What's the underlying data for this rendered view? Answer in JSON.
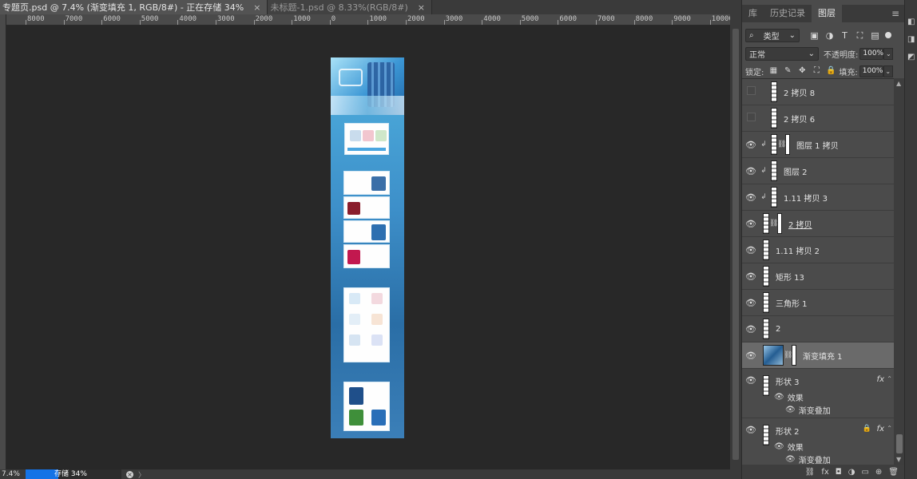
{
  "doc_tabs": [
    {
      "label": "专题页.psd @ 7.4% (渐变填充 1, RGB/8#) - 正在存储 34%",
      "close": "×",
      "active": true
    },
    {
      "label": "未标题-1.psd @ 8.33%(RGB/8#)",
      "close": "×",
      "active": false
    }
  ],
  "ruler_labels": [
    "8000",
    "7000",
    "6000",
    "5000",
    "4000",
    "3000",
    "2000",
    "1000",
    "0",
    "1000",
    "2000",
    "3000",
    "4000",
    "5000",
    "6000",
    "7000",
    "8000",
    "9000",
    "10000"
  ],
  "status": {
    "zoom": "7.4%",
    "progress_text": "存储 34%",
    "progress_fraction": 0.34,
    "cancel_icon": "×",
    "arrow": "〉"
  },
  "panel": {
    "tabs": [
      "库",
      "历史记录",
      "图层"
    ],
    "active_tab": "图层",
    "menu_icon": "≡",
    "filter_label": "类型",
    "blend_mode": "正常",
    "opacity_label": "不透明度:",
    "opacity_value": "100%",
    "lock_label": "锁定:",
    "fill_label": "填充:",
    "fill_value": "100%",
    "icons": {
      "search": "⌕",
      "caret": "⌄",
      "filter_pixel": "▣",
      "filter_adjust": "◑",
      "filter_text": "T",
      "filter_shape": "⛶",
      "filter_smart": "▤",
      "lock_pixels": "▦",
      "lock_brush": "✎",
      "lock_move": "✥",
      "lock_artboard": "⛶",
      "lock_all": "🔒",
      "eye": "👁",
      "chain": "⛓",
      "clip": "↲",
      "lock": "🔒",
      "fx": "fx",
      "expand": "⌃",
      "scroll_up": "▲",
      "scroll_down": "▼"
    },
    "layers": [
      {
        "name": "2 拷贝 8",
        "visible": false
      },
      {
        "name": "2 拷贝 6",
        "visible": false
      },
      {
        "name": "图层 1 拷贝",
        "visible": true,
        "clipped": true,
        "linked": true,
        "mask": true
      },
      {
        "name": "图层 2",
        "visible": true,
        "clipped": true
      },
      {
        "name": "1.11 拷贝 3",
        "visible": true,
        "clipped": true,
        "mask": true
      },
      {
        "name": "2 拷贝",
        "visible": true,
        "linked": true,
        "mask": true,
        "underlined": true
      },
      {
        "name": "1.11 拷贝 2",
        "visible": true
      },
      {
        "name": "矩形 13",
        "visible": true
      },
      {
        "name": "三角形 1",
        "visible": true
      },
      {
        "name": "2",
        "visible": true
      },
      {
        "name": "渐变填充 1",
        "visible": true,
        "selected": true,
        "linked": true,
        "mask": true,
        "big_thumb": true
      },
      {
        "name": "形状 3",
        "visible": true,
        "fx": true,
        "effects_label": "效果",
        "effect": "渐变叠加"
      },
      {
        "name": "形状 2",
        "visible": true,
        "fx": true,
        "locked": true,
        "effects_label": "效果",
        "effect": "渐变叠加"
      }
    ],
    "footer_icons": [
      "⛓",
      "fx",
      "◘",
      "◑",
      "▭",
      "⊕",
      "🗑"
    ]
  },
  "right_strip_icons": [
    "◧",
    "◨",
    "◩"
  ]
}
